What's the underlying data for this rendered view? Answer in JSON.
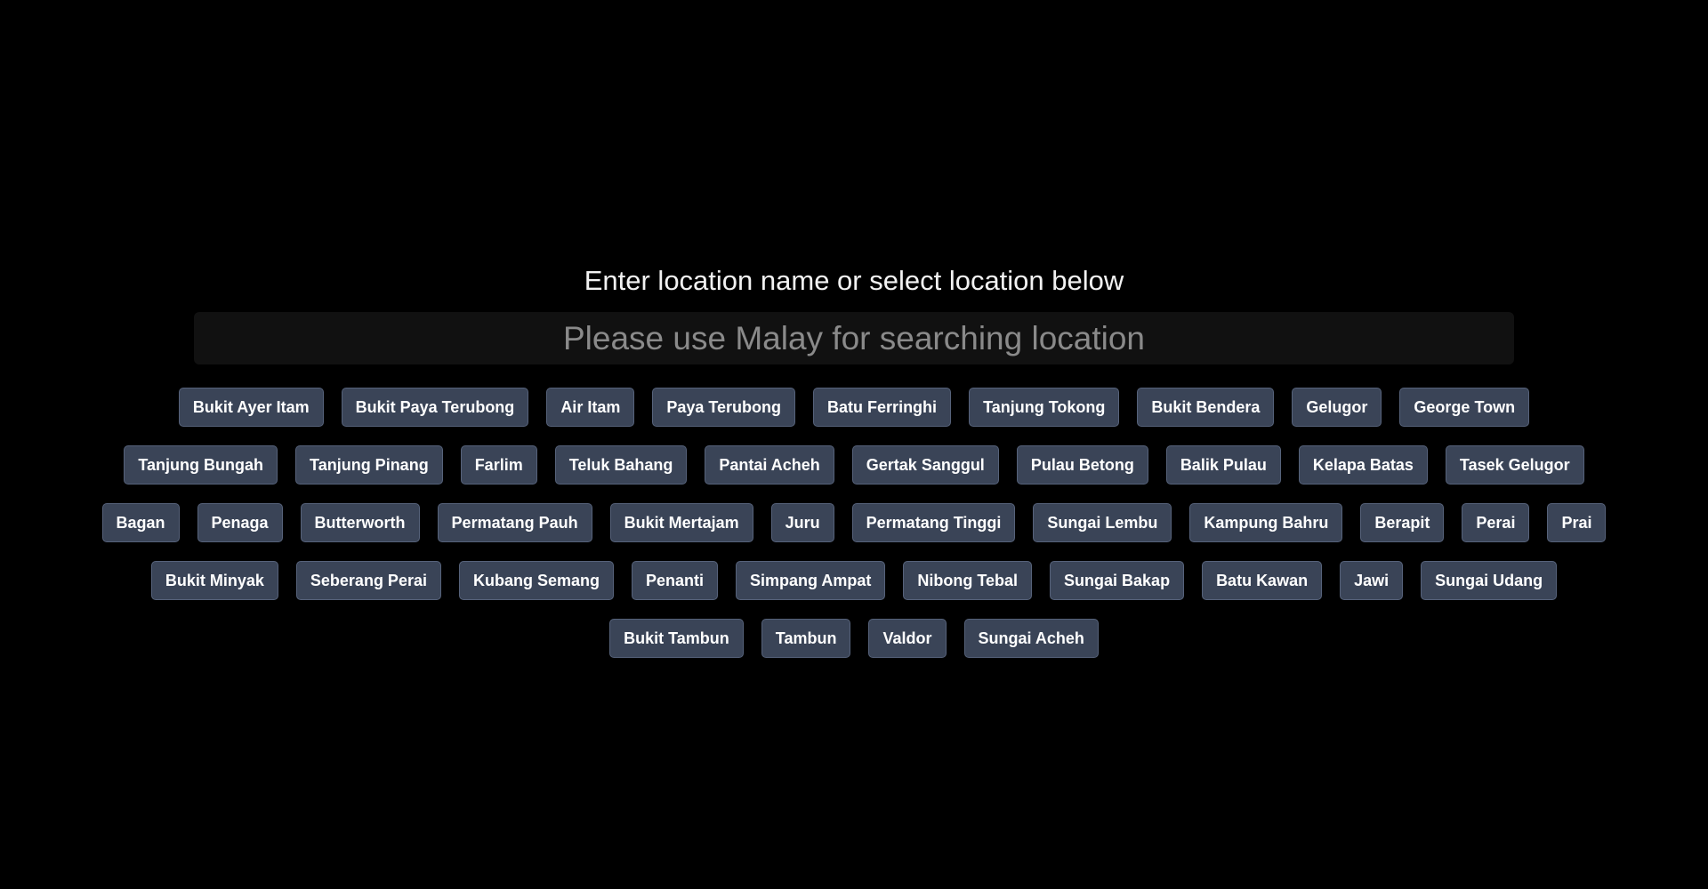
{
  "main": {
    "title": "Enter location name or select location below",
    "search": {
      "placeholder": "Please use Malay for searching location",
      "value": ""
    }
  },
  "locations": [
    "Bukit Ayer Itam",
    "Bukit Paya Terubong",
    "Air Itam",
    "Paya Terubong",
    "Batu Ferringhi",
    "Tanjung Tokong",
    "Bukit Bendera",
    "Gelugor",
    "George Town",
    "Tanjung Bungah",
    "Tanjung Pinang",
    "Farlim",
    "Teluk Bahang",
    "Pantai Acheh",
    "Gertak Sanggul",
    "Pulau Betong",
    "Balik Pulau",
    "Kelapa Batas",
    "Tasek Gelugor",
    "Bagan",
    "Penaga",
    "Butterworth",
    "Permatang Pauh",
    "Bukit Mertajam",
    "Juru",
    "Permatang Tinggi",
    "Sungai Lembu",
    "Kampung Bahru",
    "Berapit",
    "Perai",
    "Prai",
    "Bukit Minyak",
    "Seberang Perai",
    "Kubang Semang",
    "Penanti",
    "Simpang Ampat",
    "Nibong Tebal",
    "Sungai Bakap",
    "Batu Kawan",
    "Jawi",
    "Sungai Udang",
    "Bukit Tambun",
    "Tambun",
    "Valdor",
    "Sungai Acheh"
  ],
  "colors": {
    "background": "#000000",
    "button_bg": "#3a4457",
    "button_border": "#56627a",
    "input_bg": "#111111",
    "placeholder": "#8a8a8a"
  }
}
